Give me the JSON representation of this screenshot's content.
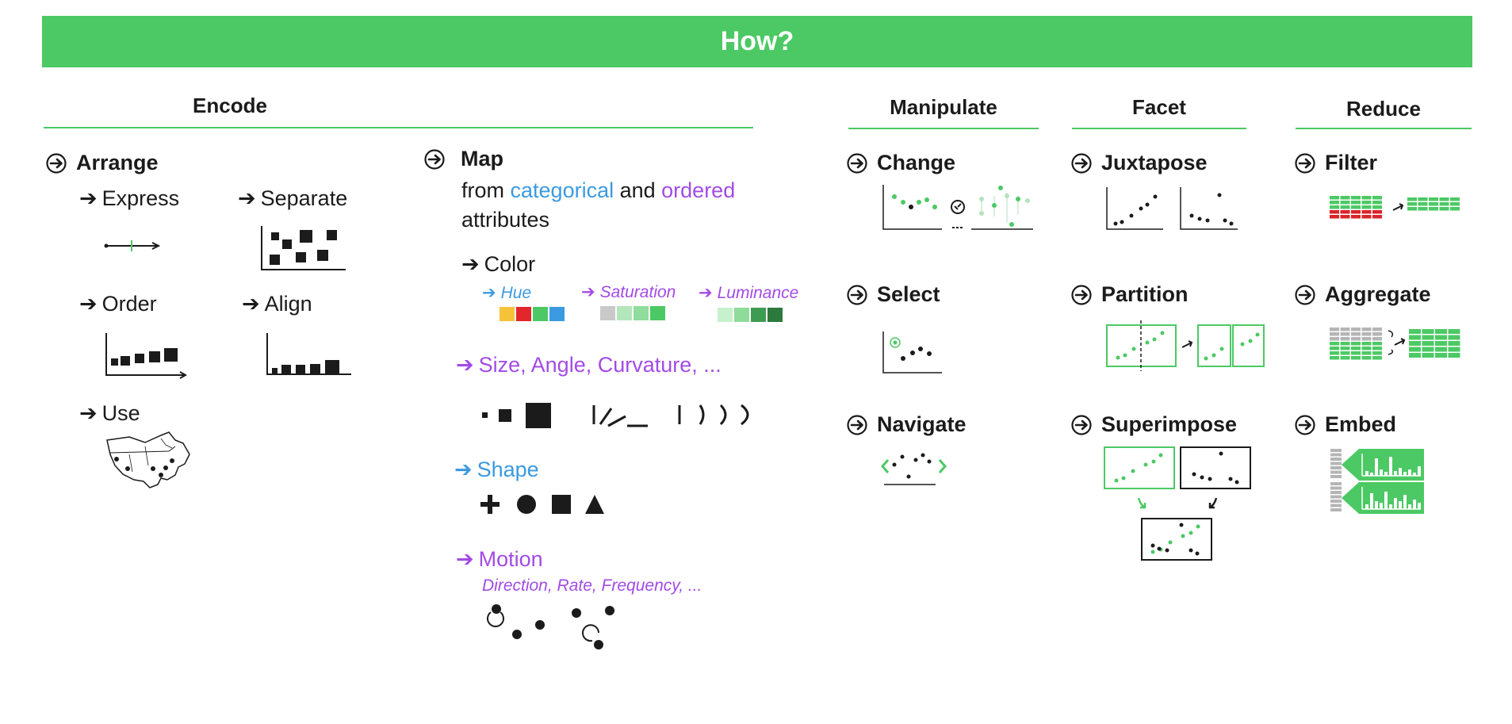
{
  "title": "How?",
  "colors": {
    "accent_green": "#4cc964",
    "categorical_blue": "#3b9ae0",
    "ordered_purple": "#a24be6",
    "filter_red": "#d8252a"
  },
  "columns": {
    "encode": "Encode",
    "manipulate": "Manipulate",
    "facet": "Facet",
    "reduce": "Reduce"
  },
  "arrange": {
    "title": "Arrange",
    "items": {
      "express": "Express",
      "separate": "Separate",
      "order": "Order",
      "align": "Align",
      "use": "Use"
    }
  },
  "map": {
    "title": "Map",
    "line1_prefix": "from ",
    "categorical": "categorical",
    "line1_mid": " and ",
    "ordered": "ordered",
    "line2": "attributes",
    "color": {
      "label": "Color",
      "hue": "Hue",
      "saturation": "Saturation",
      "luminance": "Luminance",
      "hue_swatches": [
        "#f5c23a",
        "#e2262a",
        "#4cc964",
        "#3b9ae0"
      ],
      "saturation_swatches": [
        "#c9c9c9",
        "#b3e6bb",
        "#90dc9c",
        "#4cc964"
      ],
      "luminance_swatches": [
        "#c7f0cd",
        "#8fdc9a",
        "#3e9c52",
        "#2c7a3e"
      ]
    },
    "size": "Size, Angle, Curvature, ...",
    "shape": "Shape",
    "motion": {
      "label": "Motion",
      "sub": "Direction, Rate, Frequency, ..."
    }
  },
  "manipulate": {
    "change": "Change",
    "select": "Select",
    "navigate": "Navigate"
  },
  "facet": {
    "juxtapose": "Juxtapose",
    "partition": "Partition",
    "superimpose": "Superimpose"
  },
  "reduce": {
    "filter": "Filter",
    "aggregate": "Aggregate",
    "embed": "Embed"
  },
  "icons": [
    "circled-arrow-icon",
    "arrow-right-icon"
  ]
}
